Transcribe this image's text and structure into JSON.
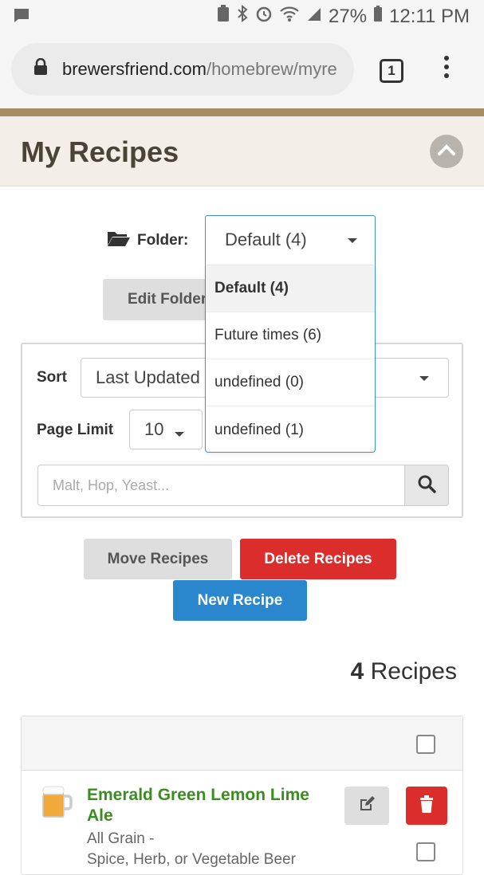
{
  "status": {
    "battery": "27%",
    "time": "12:11 PM"
  },
  "browser": {
    "url_domain": "brewersfriend.com",
    "url_path": "/homebrew/myre",
    "tab_count": "1"
  },
  "page": {
    "title": "My Recipes"
  },
  "folder": {
    "label": "Folder:",
    "selected": "Default (4)",
    "options": [
      "Default (4)",
      "Future times (6)",
      "undefined (0)",
      "undefined (1)"
    ],
    "edit_button": "Edit Folder"
  },
  "filters": {
    "sort_label": "Sort",
    "sort_value": "Last Updated",
    "limit_label": "Page Limit",
    "limit_value": "10",
    "search_placeholder": "Malt, Hop, Yeast..."
  },
  "actions": {
    "move": "Move Recipes",
    "delete": "Delete Recipes",
    "new": "New Recipe"
  },
  "summary": {
    "count": "4",
    "count_label": "Recipes"
  },
  "recipes": [
    {
      "name": "Emerald Green Lemon Lime Ale",
      "type": "All Grain  -",
      "style": "Spice, Herb, or Vegetable Beer"
    }
  ],
  "colors": {
    "accent_blue": "#2a87cd",
    "danger_red": "#dc2d2d",
    "recipe_green": "#3a8e1f",
    "header_bg": "#f3efe8",
    "stripe": "#a58d64"
  }
}
